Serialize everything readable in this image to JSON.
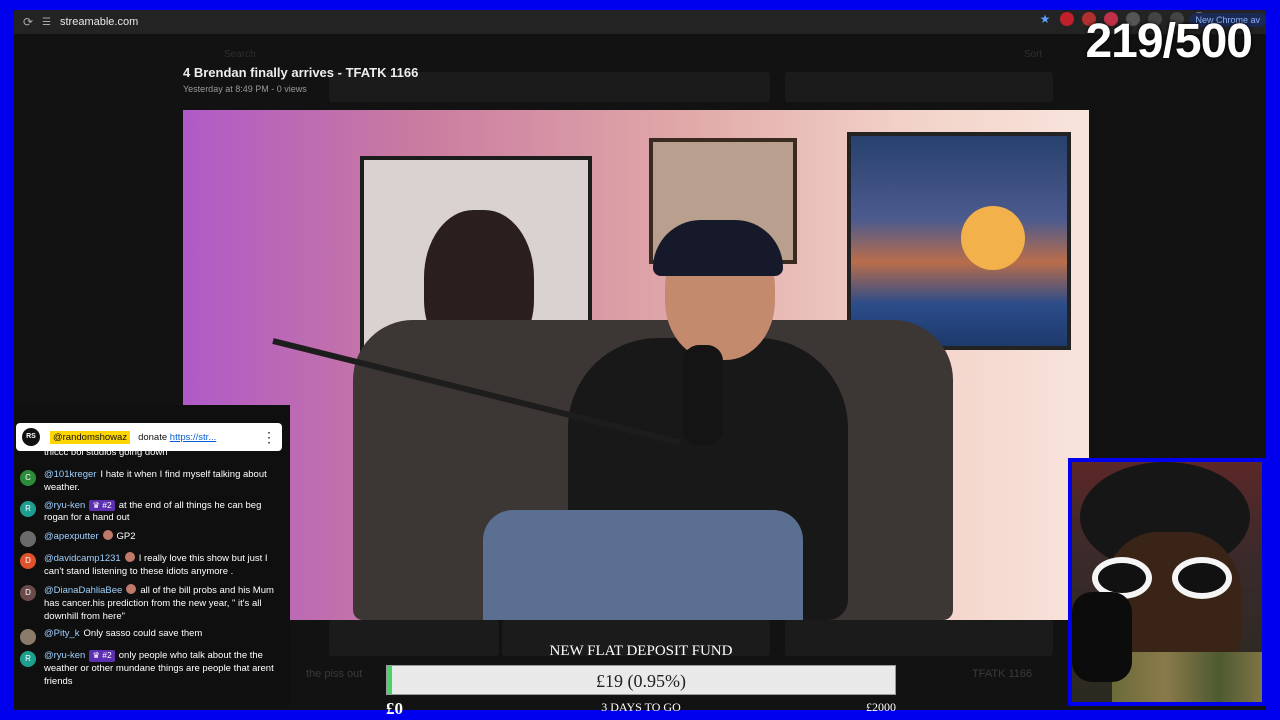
{
  "browser": {
    "url": "streamable.com",
    "update_chip": "New Chrome av"
  },
  "background": {
    "search_placeholder": "Search",
    "sort_label": "Sort",
    "card_caption_left": "the piss out",
    "card_caption_right": "TFATK 1166"
  },
  "video": {
    "title": "4 Brendan finally arrives - TFATK 1166",
    "meta": "Yesterday at 8:49 PM - 0 views"
  },
  "counter": "219/500",
  "chat": {
    "pinned": {
      "avatar": "RS",
      "user": "@randomshowaz",
      "text": "donate ",
      "link": "https://str..."
    },
    "messages": [
      {
        "avatar": "",
        "avatar_color": "#555555",
        "author": "",
        "badge": "",
        "text": "thiccc boi studios going down"
      },
      {
        "avatar": "C",
        "avatar_color": "#2e8b3a",
        "author": "@101kreger",
        "badge": "",
        "text": "I hate it when I find myself talking about weather."
      },
      {
        "avatar": "R",
        "avatar_color": "#1e9e8e",
        "author": "@ryu-ken",
        "badge": "♛ #2",
        "text": "at the end of all things he can beg rogan for a hand out"
      },
      {
        "avatar": "",
        "avatar_color": "#6a6a6a",
        "author": "@apexputter",
        "badge": "",
        "text": "GP2"
      },
      {
        "avatar": "D",
        "avatar_color": "#e0522b",
        "author": "@davidcamp1231",
        "badge": "",
        "text": "I really love this show but just I can't stand listening to these idiots anymore ."
      },
      {
        "avatar": "D",
        "avatar_color": "#6b4a4a",
        "author": "@DianaDahliaBee",
        "badge": "",
        "text": "all of the bill probs and his Mum has cancer.his prediction from the new year, \" it's all downhill from here\""
      },
      {
        "avatar": "",
        "avatar_color": "#8a7a6a",
        "author": "@Pity_k",
        "badge": "",
        "text": "Only sasso could save them"
      },
      {
        "avatar": "R",
        "avatar_color": "#1e9e8e",
        "author": "@ryu-ken",
        "badge": "♛ #2",
        "text": "only people who talk about the the weather or other mundane things are people that arent friends"
      }
    ]
  },
  "fund": {
    "title": "NEW FLAT DEPOSIT FUND",
    "amount": "£19 (0.95%)",
    "progress": 0.0095,
    "min": "£0",
    "days": "3 DAYS TO GO",
    "max": "£2000",
    "fill_color": "#4cd06a"
  }
}
